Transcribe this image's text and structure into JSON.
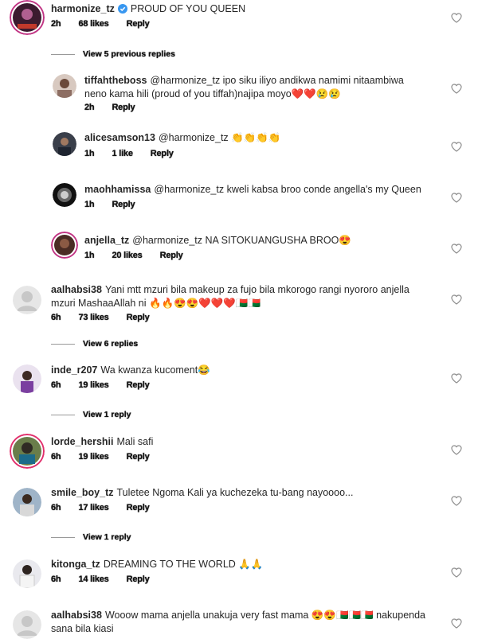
{
  "comments": [
    {
      "user": "harmonize_tz",
      "verified": true,
      "text": "PROUD OF YOU QUEEN",
      "time": "2h",
      "likes": "68 likes",
      "reply": "Reply"
    },
    {
      "user": "tiffahtheboss",
      "text": "@harmonize_tz ipo siku iliyo andikwa namimi nitaambiwa neno kama hili (proud of you tiffah)najipa moyo❤️❤️😢😢",
      "time": "2h",
      "likes": "",
      "reply": "Reply"
    },
    {
      "user": "alicesamson13",
      "text": "@harmonize_tz 👏👏👏👏",
      "time": "1h",
      "likes": "1 like",
      "reply": "Reply"
    },
    {
      "user": "maohhamissa",
      "text": "@harmonize_tz kweli kabsa broo conde angella's my Queen",
      "time": "1h",
      "likes": "",
      "reply": "Reply"
    },
    {
      "user": "anjella_tz",
      "text": "@harmonize_tz NA SITOKUANGUSHA BROO😍",
      "time": "1h",
      "likes": "20 likes",
      "reply": "Reply"
    },
    {
      "user": "aalhabsi38",
      "text": "Yani mtt mzuri bila makeup za fujo bila mkorogo rangi nyororo anjella mzuri MashaaAllah ni 🔥🔥😍😍❤️❤️❤️🇲🇬🇲🇬",
      "time": "6h",
      "likes": "73 likes",
      "reply": "Reply"
    },
    {
      "user": "inde_r207",
      "text": "Wa kwanza kucoment😂",
      "time": "6h",
      "likes": "19 likes",
      "reply": "Reply"
    },
    {
      "user": "lorde_hershii",
      "text": "Mali safi",
      "time": "6h",
      "likes": "19 likes",
      "reply": "Reply"
    },
    {
      "user": "smile_boy_tz",
      "text": "Tuletee Ngoma Kali ya kuchezeka tu-bang nayoooo...",
      "time": "6h",
      "likes": "17 likes",
      "reply": "Reply"
    },
    {
      "user": "kitonga_tz",
      "text": "DREAMING TO THE WORLD 🙏🙏",
      "time": "6h",
      "likes": "14 likes",
      "reply": "Reply"
    },
    {
      "user": "aalhabsi38",
      "text": "Wooow mama anjella unakuja very fast mama 😍😍🇲🇬🇲🇬🇲🇬 nakupenda sana bila kiasi",
      "time": "",
      "likes": "",
      "reply": ""
    }
  ],
  "view_more": [
    "View 5 previous replies",
    "View 6 replies",
    "View 1 reply",
    "View 1 reply"
  ],
  "colors": {
    "text": "#262626",
    "verified": "#3897f0",
    "heart_outline": "#8e8e8e"
  }
}
